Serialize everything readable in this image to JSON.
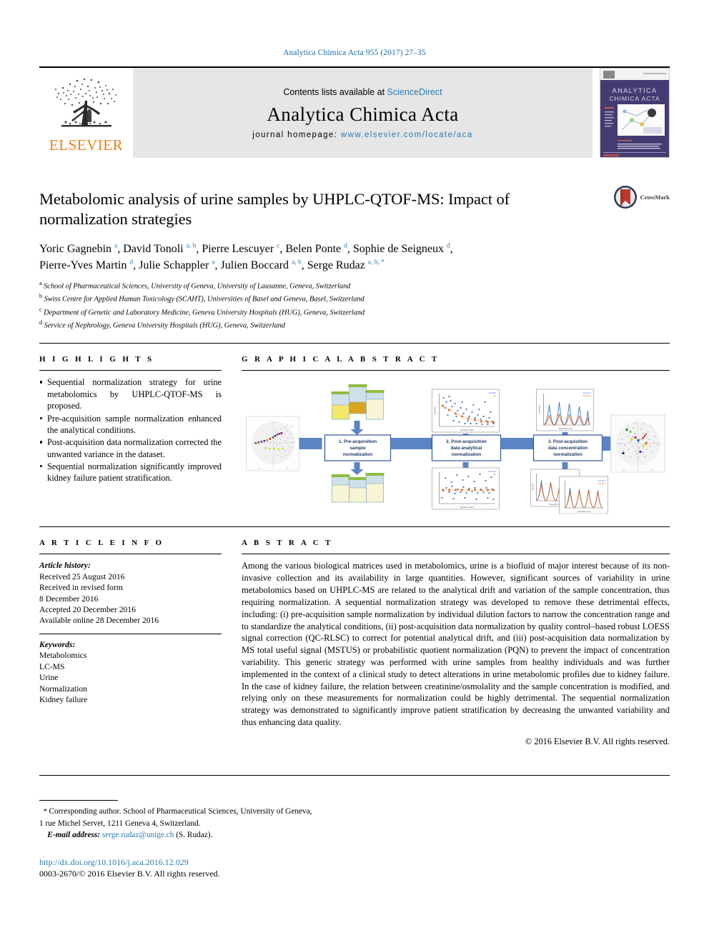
{
  "running_head": "Analytica Chimica Acta 955 (2017) 27–35",
  "masthead": {
    "publisher": "ELSEVIER",
    "contents_prefix": "Contents lists available at ",
    "contents_link": "ScienceDirect",
    "journal_title": "Analytica Chimica Acta",
    "homepage_label": "journal homepage: ",
    "homepage_url": "www.elsevier.com/locate/aca",
    "cover_title_line1": "ANALYTICA",
    "cover_title_line2": "CHIMICA ACTA"
  },
  "article": {
    "title": "Metabolomic analysis of urine samples by UHPLC-QTOF-MS: Impact of normalization strategies",
    "crossmark_label": "CrossMark",
    "authors_line1": [
      {
        "name": "Yoric Gagnebin",
        "sup": "a"
      },
      {
        "name": "David Tonoli",
        "sup": "a, b"
      },
      {
        "name": "Pierre Lescuyer",
        "sup": "c"
      },
      {
        "name": "Belen Ponte",
        "sup": "d"
      },
      {
        "name": "Sophie de Seigneux",
        "sup": "d"
      }
    ],
    "authors_line2": [
      {
        "name": "Pierre-Yves Martin",
        "sup": "d"
      },
      {
        "name": "Julie Schappler",
        "sup": "a"
      },
      {
        "name": "Julien Boccard",
        "sup": "a, b"
      },
      {
        "name": "Serge Rudaz",
        "sup": "a, b, *"
      }
    ],
    "affiliations": [
      {
        "sup": "a",
        "text": "School of Pharmaceutical Sciences, University of Geneva, University of Lausanne, Geneva, Switzerland"
      },
      {
        "sup": "b",
        "text": "Swiss Centre for Applied Human Toxicology (SCAHT), Universities of Basel and Geneva, Basel, Switzerland"
      },
      {
        "sup": "c",
        "text": "Department of Genetic and Laboratory Medicine, Geneva University Hospitals (HUG), Geneva, Switzerland"
      },
      {
        "sup": "d",
        "text": "Service of Nephrology, Geneva University Hospitals (HUG), Geneva, Switzerland"
      }
    ]
  },
  "highlights": {
    "heading": "H I G H L I G H T S",
    "items": [
      "Sequential normalization strategy for urine metabolomics by UHPLC-QTOF-MS is proposed.",
      "Pre-acquisition sample normalization enhanced the analytical conditions.",
      "Post-acquisition data normalization corrected the unwanted variance in the dataset.",
      "Sequential normalization significantly improved kidney failure patient stratification."
    ]
  },
  "graphical_abstract": {
    "heading": "G R A P H I C A L   A B S T R A C T",
    "steps": [
      "1. Pre-acquisition sample normalization",
      "2. Post-acquisition data analytical normalization",
      "3. Post-acquisition data concentration normalization"
    ],
    "step_lines": [
      [
        "1. Pre-acquisition",
        "sample",
        "normalization"
      ],
      [
        "2. Post-acquisition",
        "data analytical",
        "normalization"
      ],
      [
        "3. Post-acquisition",
        "data concentration",
        "normalization"
      ]
    ],
    "panel_labels": {
      "scatter_x": "Injection order",
      "scatter_y": "Intensity",
      "chrom_x": "Retention time",
      "chrom_y": "Intensity",
      "legend_sample1": "Sample 1",
      "legend_sample2": "Sample 2",
      "pca_x": "t[1]",
      "pca_y": "t[2]"
    },
    "colors": {
      "arrow": "#5b84c4",
      "box_border": "#2f5597",
      "urine_yellow": "#f2e96b",
      "urine_pale": "#f7f5d6",
      "cap_green": "#8fbc3f",
      "scatter_blue": "#3a6fc4",
      "qc_orange": "#e07b30"
    }
  },
  "article_info": {
    "heading": "A R T I C L E   I N F O",
    "history_label": "Article history:",
    "history": [
      "Received 25 August 2016",
      "Received in revised form",
      "8 December 2016",
      "Accepted 20 December 2016",
      "Available online 28 December 2016"
    ],
    "keywords_label": "Keywords:",
    "keywords": [
      "Metabolomics",
      "LC-MS",
      "Urine",
      "Normalization",
      "Kidney failure"
    ]
  },
  "abstract": {
    "heading": "A B S T R A C T",
    "text": "Among the various biological matrices used in metabolomics, urine is a biofluid of major interest because of its non-invasive collection and its availability in large quantities. However, significant sources of variability in urine metabolomics based on UHPLC-MS are related to the analytical drift and variation of the sample concentration, thus requiring normalization. A sequential normalization strategy was developed to remove these detrimental effects, including: (i) pre-acquisition sample normalization by individual dilution factors to narrow the concentration range and to standardize the analytical conditions, (ii) post-acquisition data normalization by quality control–based robust LOESS signal correction (QC-RLSC) to correct for potential analytical drift, and (iii) post-acquisition data normalization by MS total useful signal (MSTUS) or probabilistic quotient normalization (PQN) to prevent the impact of concentration variability. This generic strategy was performed with urine samples from healthy individuals and was further implemented in the context of a clinical study to detect alterations in urine metabolomic profiles due to kidney failure. In the case of kidney failure, the relation between creatinine/osmolality and the sample concentration is modified, and relying only on these measurements for normalization could be highly detrimental. The sequential normalization strategy was demonstrated to significantly improve patient stratification by decreasing the unwanted variability and thus enhancing data quality.",
    "copyright": "© 2016 Elsevier B.V. All rights reserved."
  },
  "footer": {
    "corresponding_star": "*",
    "corresponding_line1": "Corresponding author. School of Pharmaceutical Sciences, University of Geneva,",
    "corresponding_line2": "1 rue Michel Servet, 1211 Geneva 4, Switzerland.",
    "email_label": "E-mail address:",
    "email": "serge.rudaz@unige.ch",
    "email_owner": "(S. Rudaz).",
    "doi": "http://dx.doi.org/10.1016/j.aca.2016.12.029",
    "issn": "0003-2670/© 2016 Elsevier B.V. All rights reserved."
  },
  "colors": {
    "link": "#2a7ab0",
    "elsevier_orange": "#f07f13",
    "masthead_grey": "#e6e6e6",
    "cover_purple": "#3b3466"
  }
}
